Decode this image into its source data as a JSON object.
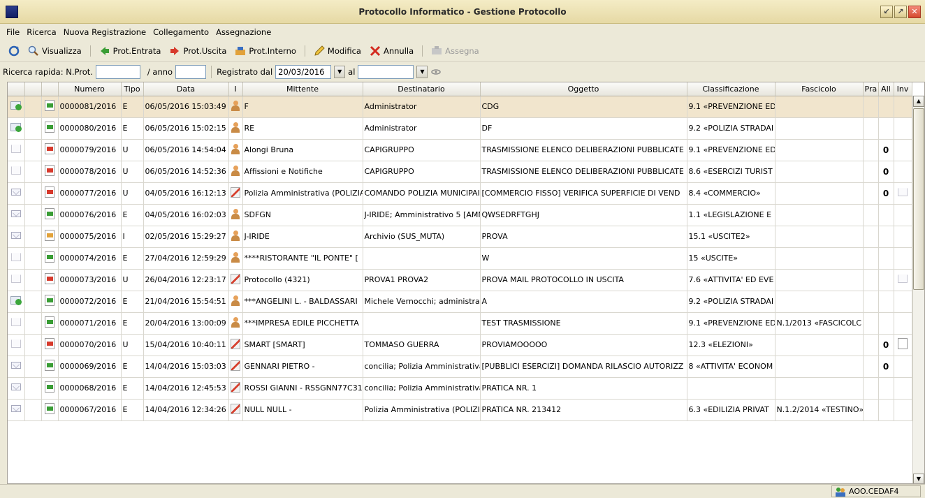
{
  "window": {
    "title": "Protocollo Informatico - Gestione Protocollo",
    "buttons": {
      "minimize": "↙",
      "maximize": "↗",
      "close": "✕"
    }
  },
  "menu": [
    "File",
    "Ricerca",
    "Nuova Registrazione",
    "Collegamento",
    "Assegnazione"
  ],
  "toolbar": {
    "visualizza": "Visualizza",
    "prot_entrata": "Prot.Entrata",
    "prot_uscita": "Prot.Uscita",
    "prot_interno": "Prot.Interno",
    "modifica": "Modifica",
    "annulla": "Annulla",
    "assegna": "Assegna"
  },
  "search": {
    "label": "Ricerca rapida: N.Prot.",
    "nprot": "",
    "anno_label": "/ anno",
    "anno": "",
    "registrato_label": "Registrato dal",
    "registrato_dal": "20/03/2016",
    "al_label": "al",
    "al": ""
  },
  "columns": [
    "",
    "",
    "",
    "Numero",
    "Tipo",
    "Data",
    "I",
    "Mittente",
    "Destinatario",
    "Oggetto",
    "Classificazione",
    "Fascicolo",
    "Pra",
    "All",
    "Inv"
  ],
  "rows": [
    {
      "status": "ok",
      "doc": "in",
      "numero": "0000081/2016",
      "tipo": "E",
      "data": "06/05/2016 15:03:49",
      "i": "person",
      "mittente": "F",
      "destinatario": "Administrator",
      "oggetto": "CDG",
      "classificazione": "9.1 «PREVENZIONE ED",
      "fascicolo": "",
      "all": "",
      "inv": ""
    },
    {
      "status": "ok",
      "doc": "in",
      "numero": "0000080/2016",
      "tipo": "E",
      "data": "06/05/2016 15:02:15",
      "i": "person",
      "mittente": "RE",
      "destinatario": "Administrator",
      "oggetto": "DF",
      "classificazione": "9.2 «POLIZIA STRADAI",
      "fascicolo": "",
      "all": "",
      "inv": ""
    },
    {
      "status": "open",
      "doc": "out",
      "numero": "0000079/2016",
      "tipo": "U",
      "data": "06/05/2016 14:54:04",
      "i": "person",
      "mittente": "Alongi Bruna",
      "destinatario": "CAPIGRUPPO",
      "oggetto": "TRASMISSIONE ELENCO DELIBERAZIONI PUBBLICATE",
      "classificazione": "9.1 «PREVENZIONE ED",
      "fascicolo": "",
      "all": "0",
      "inv": ""
    },
    {
      "status": "open",
      "doc": "out",
      "numero": "0000078/2016",
      "tipo": "U",
      "data": "06/05/2016 14:52:36",
      "i": "person",
      "mittente": "Affissioni e Notifiche",
      "destinatario": "CAPIGRUPPO",
      "oggetto": "TRASMISSIONE ELENCO DELIBERAZIONI PUBBLICATE",
      "classificazione": "8.6 «ESERCIZI TURIST",
      "fascicolo": "",
      "all": "0",
      "inv": ""
    },
    {
      "status": "env",
      "doc": "out",
      "numero": "0000077/2016",
      "tipo": "U",
      "data": "04/05/2016 16:12:13",
      "i": "pen",
      "mittente": "Polizia Amministrativa (POLIZIA",
      "destinatario": "COMANDO POLIZIA MUNICIPAI",
      "oggetto": "[COMMERCIO FISSO] VERIFICA SUPERFICIE DI VEND",
      "classificazione": "8.4 «COMMERCIO»",
      "fascicolo": "",
      "all": "0",
      "inv": "env"
    },
    {
      "status": "env",
      "doc": "in",
      "numero": "0000076/2016",
      "tipo": "E",
      "data": "04/05/2016 16:02:03",
      "i": "person",
      "mittente": "SDFGN",
      "destinatario": "J-IRIDE; Amministrativo 5 [AMN",
      "oggetto": "QWSEDRFTGHJ",
      "classificazione": "1.1 «LEGISLAZIONE E",
      "fascicolo": "",
      "all": "",
      "inv": ""
    },
    {
      "status": "env",
      "doc": "int",
      "numero": "0000075/2016",
      "tipo": "I",
      "data": "02/05/2016 15:29:27",
      "i": "person",
      "mittente": "J-IRIDE",
      "destinatario": "Archivio (SUS_MUTA)",
      "oggetto": "PROVA",
      "classificazione": "15.1 «USCITE2»",
      "fascicolo": "",
      "all": "",
      "inv": ""
    },
    {
      "status": "open",
      "doc": "in",
      "numero": "0000074/2016",
      "tipo": "E",
      "data": "27/04/2016 12:59:29",
      "i": "person",
      "mittente": "****RISTORANTE \"IL PONTE\" [",
      "destinatario": "",
      "oggetto": "W",
      "classificazione": "15 «USCITE»",
      "fascicolo": "",
      "all": "",
      "inv": ""
    },
    {
      "status": "open",
      "doc": "out",
      "numero": "0000073/2016",
      "tipo": "U",
      "data": "26/04/2016 12:23:17",
      "i": "pen",
      "mittente": "Protocollo (4321)",
      "destinatario": "PROVA1 PROVA2",
      "oggetto": "PROVA MAIL PROTOCOLLO IN USCITA",
      "classificazione": "7.6 «ATTIVITA' ED EVE",
      "fascicolo": "",
      "all": "",
      "inv": "open"
    },
    {
      "status": "ok",
      "doc": "in",
      "numero": "0000072/2016",
      "tipo": "E",
      "data": "21/04/2016 15:54:51",
      "i": "person",
      "mittente": "***ANGELINI L. - BALDASSARI",
      "destinatario": "Michele Vernocchi; administrato",
      "oggetto": "A",
      "classificazione": "9.2 «POLIZIA STRADAI",
      "fascicolo": "",
      "all": "",
      "inv": ""
    },
    {
      "status": "open",
      "doc": "in",
      "numero": "0000071/2016",
      "tipo": "E",
      "data": "20/04/2016 13:00:09",
      "i": "person",
      "mittente": "***IMPRESA EDILE PICCHETTA",
      "destinatario": "",
      "oggetto": "TEST TRASMISSIONE",
      "classificazione": "9.1 «PREVENZIONE ED",
      "fascicolo": "N.1/2013 «FASCICOLC",
      "all": "",
      "inv": ""
    },
    {
      "status": "open",
      "doc": "out",
      "numero": "0000070/2016",
      "tipo": "U",
      "data": "15/04/2016 10:40:11",
      "i": "pen",
      "mittente": "SMART [SMART]",
      "destinatario": "TOMMASO GUERRA",
      "oggetto": "PROVIAMOOOOO",
      "classificazione": "12.3 «ELEZIONI»",
      "fascicolo": "",
      "all": "0",
      "inv": "doc"
    },
    {
      "status": "env",
      "doc": "in",
      "numero": "0000069/2016",
      "tipo": "E",
      "data": "14/04/2016 15:03:03",
      "i": "pen",
      "mittente": "GENNARI PIETRO -",
      "destinatario": "concilia; Polizia Amministrativa (",
      "oggetto": "[PUBBLICI ESERCIZI] DOMANDA RILASCIO AUTORIZZ",
      "classificazione": "8 «ATTIVITA' ECONOM",
      "fascicolo": "",
      "all": "0",
      "inv": ""
    },
    {
      "status": "env",
      "doc": "in",
      "numero": "0000068/2016",
      "tipo": "E",
      "data": "14/04/2016 12:45:53",
      "i": "pen",
      "mittente": "ROSSI GIANNI - RSSGNN77C31",
      "destinatario": "concilia; Polizia Amministrativa (",
      "oggetto": "PRATICA NR. 1",
      "classificazione": "",
      "fascicolo": "",
      "all": "",
      "inv": ""
    },
    {
      "status": "env",
      "doc": "in",
      "numero": "0000067/2016",
      "tipo": "E",
      "data": "14/04/2016 12:34:26",
      "i": "pen",
      "mittente": "NULL NULL -",
      "destinatario": "Polizia Amministrativa (POLIZIA",
      "oggetto": "PRATICA NR. 213412",
      "classificazione": "6.3 «EDILIZIA PRIVAT",
      "fascicolo": "N.1.2/2014 «TESTINO»",
      "all": "",
      "inv": ""
    }
  ],
  "status": {
    "aoo": "AOO.CEDAF4"
  }
}
